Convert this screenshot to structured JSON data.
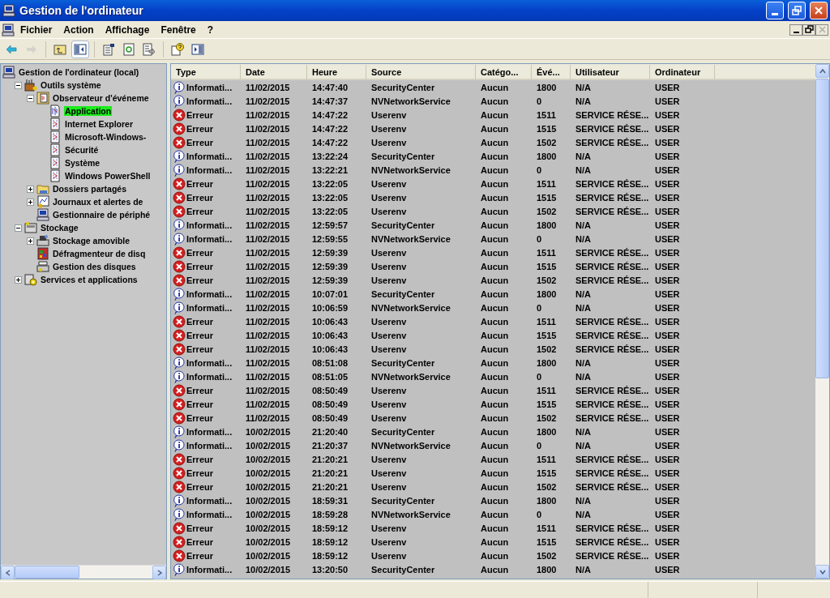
{
  "window": {
    "title": "Gestion de l'ordinateur"
  },
  "menu": [
    "Fichier",
    "Action",
    "Affichage",
    "Fenêtre",
    "?"
  ],
  "toolbar": [
    {
      "kind": "back",
      "disabled": false,
      "pressed": false
    },
    {
      "kind": "forward",
      "disabled": true,
      "pressed": false
    },
    {
      "kind": "sep"
    },
    {
      "kind": "up",
      "disabled": false,
      "pressed": false
    },
    {
      "kind": "tree",
      "disabled": false,
      "pressed": true
    },
    {
      "kind": "sep"
    },
    {
      "kind": "properties",
      "disabled": false,
      "pressed": false
    },
    {
      "kind": "refresh",
      "disabled": false,
      "pressed": false
    },
    {
      "kind": "export",
      "disabled": false,
      "pressed": false
    },
    {
      "kind": "sep"
    },
    {
      "kind": "help",
      "disabled": false,
      "pressed": false
    },
    {
      "kind": "pane",
      "disabled": false,
      "pressed": false
    }
  ],
  "tree": [
    {
      "label": "Gestion de l'ordinateur (local)",
      "kind": "computer",
      "selected": false,
      "children": [
        {
          "label": "Outils système",
          "kind": "tools",
          "selected": false,
          "expanded": true,
          "children": [
            {
              "label": "Observateur d'événeme",
              "kind": "viewer",
              "selected": false,
              "expanded": true,
              "children": [
                {
                  "label": "Application",
                  "kind": "logopen",
                  "selected": true
                },
                {
                  "label": "Internet Explorer",
                  "kind": "log",
                  "selected": false
                },
                {
                  "label": "Microsoft-Windows-",
                  "kind": "log",
                  "selected": false
                },
                {
                  "label": "Sécurité",
                  "kind": "log",
                  "selected": false
                },
                {
                  "label": "Système",
                  "kind": "log",
                  "selected": false
                },
                {
                  "label": "Windows PowerShell",
                  "kind": "log",
                  "selected": false
                }
              ]
            },
            {
              "label": "Dossiers partagés",
              "kind": "folder",
              "selected": false,
              "expanded": false
            },
            {
              "label": "Journaux et alertes de",
              "kind": "chart",
              "selected": false,
              "expanded": false
            },
            {
              "label": "Gestionnaire de périphé",
              "kind": "computer",
              "selected": false
            }
          ]
        },
        {
          "label": "Stockage",
          "kind": "storage",
          "selected": false,
          "expanded": true,
          "children": [
            {
              "label": "Stockage amovible",
              "kind": "removable",
              "selected": false,
              "expanded": false
            },
            {
              "label": "Défragmenteur de disq",
              "kind": "defrag",
              "selected": false
            },
            {
              "label": "Gestion des disques",
              "kind": "disk",
              "selected": false
            }
          ]
        },
        {
          "label": "Services et applications",
          "kind": "services",
          "selected": false,
          "expanded": false
        }
      ]
    }
  ],
  "table": {
    "columns": [
      "Type",
      "Date",
      "Heure",
      "Source",
      "Catégo...",
      "Évé...",
      "Utilisateur",
      "Ordinateur"
    ],
    "rows": [
      {
        "kind": "info",
        "type": "Informati...",
        "date": "11/02/2015",
        "time": "14:47:40",
        "source": "SecurityCenter",
        "category": "Aucun",
        "event": "1800",
        "user": "N/A",
        "computer": "USER"
      },
      {
        "kind": "info",
        "type": "Informati...",
        "date": "11/02/2015",
        "time": "14:47:37",
        "source": "NVNetworkService",
        "category": "Aucun",
        "event": "0",
        "user": "N/A",
        "computer": "USER"
      },
      {
        "kind": "error",
        "type": "Erreur",
        "date": "11/02/2015",
        "time": "14:47:22",
        "source": "Userenv",
        "category": "Aucun",
        "event": "1511",
        "user": "SERVICE RÉSE...",
        "computer": "USER"
      },
      {
        "kind": "error",
        "type": "Erreur",
        "date": "11/02/2015",
        "time": "14:47:22",
        "source": "Userenv",
        "category": "Aucun",
        "event": "1515",
        "user": "SERVICE RÉSE...",
        "computer": "USER"
      },
      {
        "kind": "error",
        "type": "Erreur",
        "date": "11/02/2015",
        "time": "14:47:22",
        "source": "Userenv",
        "category": "Aucun",
        "event": "1502",
        "user": "SERVICE RÉSE...",
        "computer": "USER"
      },
      {
        "kind": "info",
        "type": "Informati...",
        "date": "11/02/2015",
        "time": "13:22:24",
        "source": "SecurityCenter",
        "category": "Aucun",
        "event": "1800",
        "user": "N/A",
        "computer": "USER"
      },
      {
        "kind": "info",
        "type": "Informati...",
        "date": "11/02/2015",
        "time": "13:22:21",
        "source": "NVNetworkService",
        "category": "Aucun",
        "event": "0",
        "user": "N/A",
        "computer": "USER"
      },
      {
        "kind": "error",
        "type": "Erreur",
        "date": "11/02/2015",
        "time": "13:22:05",
        "source": "Userenv",
        "category": "Aucun",
        "event": "1511",
        "user": "SERVICE RÉSE...",
        "computer": "USER"
      },
      {
        "kind": "error",
        "type": "Erreur",
        "date": "11/02/2015",
        "time": "13:22:05",
        "source": "Userenv",
        "category": "Aucun",
        "event": "1515",
        "user": "SERVICE RÉSE...",
        "computer": "USER"
      },
      {
        "kind": "error",
        "type": "Erreur",
        "date": "11/02/2015",
        "time": "13:22:05",
        "source": "Userenv",
        "category": "Aucun",
        "event": "1502",
        "user": "SERVICE RÉSE...",
        "computer": "USER"
      },
      {
        "kind": "info",
        "type": "Informati...",
        "date": "11/02/2015",
        "time": "12:59:57",
        "source": "SecurityCenter",
        "category": "Aucun",
        "event": "1800",
        "user": "N/A",
        "computer": "USER"
      },
      {
        "kind": "info",
        "type": "Informati...",
        "date": "11/02/2015",
        "time": "12:59:55",
        "source": "NVNetworkService",
        "category": "Aucun",
        "event": "0",
        "user": "N/A",
        "computer": "USER"
      },
      {
        "kind": "error",
        "type": "Erreur",
        "date": "11/02/2015",
        "time": "12:59:39",
        "source": "Userenv",
        "category": "Aucun",
        "event": "1511",
        "user": "SERVICE RÉSE...",
        "computer": "USER"
      },
      {
        "kind": "error",
        "type": "Erreur",
        "date": "11/02/2015",
        "time": "12:59:39",
        "source": "Userenv",
        "category": "Aucun",
        "event": "1515",
        "user": "SERVICE RÉSE...",
        "computer": "USER"
      },
      {
        "kind": "error",
        "type": "Erreur",
        "date": "11/02/2015",
        "time": "12:59:39",
        "source": "Userenv",
        "category": "Aucun",
        "event": "1502",
        "user": "SERVICE RÉSE...",
        "computer": "USER"
      },
      {
        "kind": "info",
        "type": "Informati...",
        "date": "11/02/2015",
        "time": "10:07:01",
        "source": "SecurityCenter",
        "category": "Aucun",
        "event": "1800",
        "user": "N/A",
        "computer": "USER"
      },
      {
        "kind": "info",
        "type": "Informati...",
        "date": "11/02/2015",
        "time": "10:06:59",
        "source": "NVNetworkService",
        "category": "Aucun",
        "event": "0",
        "user": "N/A",
        "computer": "USER"
      },
      {
        "kind": "error",
        "type": "Erreur",
        "date": "11/02/2015",
        "time": "10:06:43",
        "source": "Userenv",
        "category": "Aucun",
        "event": "1511",
        "user": "SERVICE RÉSE...",
        "computer": "USER"
      },
      {
        "kind": "error",
        "type": "Erreur",
        "date": "11/02/2015",
        "time": "10:06:43",
        "source": "Userenv",
        "category": "Aucun",
        "event": "1515",
        "user": "SERVICE RÉSE...",
        "computer": "USER"
      },
      {
        "kind": "error",
        "type": "Erreur",
        "date": "11/02/2015",
        "time": "10:06:43",
        "source": "Userenv",
        "category": "Aucun",
        "event": "1502",
        "user": "SERVICE RÉSE...",
        "computer": "USER"
      },
      {
        "kind": "info",
        "type": "Informati...",
        "date": "11/02/2015",
        "time": "08:51:08",
        "source": "SecurityCenter",
        "category": "Aucun",
        "event": "1800",
        "user": "N/A",
        "computer": "USER"
      },
      {
        "kind": "info",
        "type": "Informati...",
        "date": "11/02/2015",
        "time": "08:51:05",
        "source": "NVNetworkService",
        "category": "Aucun",
        "event": "0",
        "user": "N/A",
        "computer": "USER"
      },
      {
        "kind": "error",
        "type": "Erreur",
        "date": "11/02/2015",
        "time": "08:50:49",
        "source": "Userenv",
        "category": "Aucun",
        "event": "1511",
        "user": "SERVICE RÉSE...",
        "computer": "USER"
      },
      {
        "kind": "error",
        "type": "Erreur",
        "date": "11/02/2015",
        "time": "08:50:49",
        "source": "Userenv",
        "category": "Aucun",
        "event": "1515",
        "user": "SERVICE RÉSE...",
        "computer": "USER"
      },
      {
        "kind": "error",
        "type": "Erreur",
        "date": "11/02/2015",
        "time": "08:50:49",
        "source": "Userenv",
        "category": "Aucun",
        "event": "1502",
        "user": "SERVICE RÉSE...",
        "computer": "USER"
      },
      {
        "kind": "info",
        "type": "Informati...",
        "date": "10/02/2015",
        "time": "21:20:40",
        "source": "SecurityCenter",
        "category": "Aucun",
        "event": "1800",
        "user": "N/A",
        "computer": "USER"
      },
      {
        "kind": "info",
        "type": "Informati...",
        "date": "10/02/2015",
        "time": "21:20:37",
        "source": "NVNetworkService",
        "category": "Aucun",
        "event": "0",
        "user": "N/A",
        "computer": "USER"
      },
      {
        "kind": "error",
        "type": "Erreur",
        "date": "10/02/2015",
        "time": "21:20:21",
        "source": "Userenv",
        "category": "Aucun",
        "event": "1511",
        "user": "SERVICE RÉSE...",
        "computer": "USER"
      },
      {
        "kind": "error",
        "type": "Erreur",
        "date": "10/02/2015",
        "time": "21:20:21",
        "source": "Userenv",
        "category": "Aucun",
        "event": "1515",
        "user": "SERVICE RÉSE...",
        "computer": "USER"
      },
      {
        "kind": "error",
        "type": "Erreur",
        "date": "10/02/2015",
        "time": "21:20:21",
        "source": "Userenv",
        "category": "Aucun",
        "event": "1502",
        "user": "SERVICE RÉSE...",
        "computer": "USER"
      },
      {
        "kind": "info",
        "type": "Informati...",
        "date": "10/02/2015",
        "time": "18:59:31",
        "source": "SecurityCenter",
        "category": "Aucun",
        "event": "1800",
        "user": "N/A",
        "computer": "USER"
      },
      {
        "kind": "info",
        "type": "Informati...",
        "date": "10/02/2015",
        "time": "18:59:28",
        "source": "NVNetworkService",
        "category": "Aucun",
        "event": "0",
        "user": "N/A",
        "computer": "USER"
      },
      {
        "kind": "error",
        "type": "Erreur",
        "date": "10/02/2015",
        "time": "18:59:12",
        "source": "Userenv",
        "category": "Aucun",
        "event": "1511",
        "user": "SERVICE RÉSE...",
        "computer": "USER"
      },
      {
        "kind": "error",
        "type": "Erreur",
        "date": "10/02/2015",
        "time": "18:59:12",
        "source": "Userenv",
        "category": "Aucun",
        "event": "1515",
        "user": "SERVICE RÉSE...",
        "computer": "USER"
      },
      {
        "kind": "error",
        "type": "Erreur",
        "date": "10/02/2015",
        "time": "18:59:12",
        "source": "Userenv",
        "category": "Aucun",
        "event": "1502",
        "user": "SERVICE RÉSE...",
        "computer": "USER"
      },
      {
        "kind": "info",
        "type": "Informati...",
        "date": "10/02/2015",
        "time": "13:20:50",
        "source": "SecurityCenter",
        "category": "Aucun",
        "event": "1800",
        "user": "N/A",
        "computer": "USER"
      }
    ]
  }
}
